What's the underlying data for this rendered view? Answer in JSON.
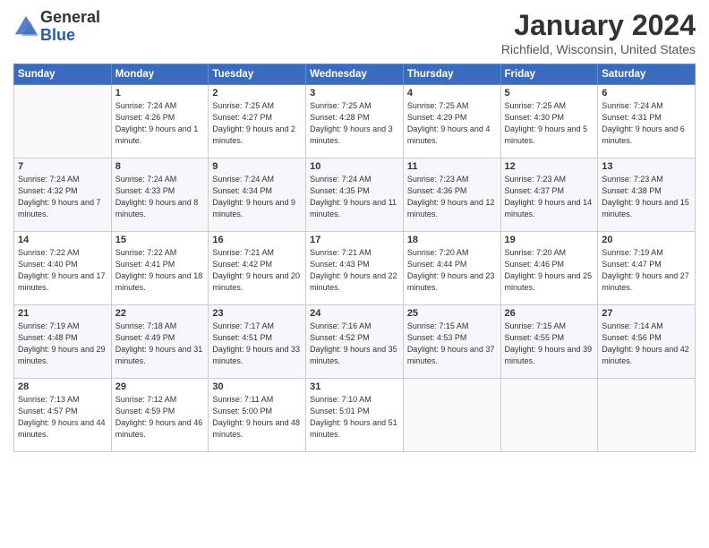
{
  "logo": {
    "general": "General",
    "blue": "Blue"
  },
  "header": {
    "month_year": "January 2024",
    "location": "Richfield, Wisconsin, United States"
  },
  "days_of_week": [
    "Sunday",
    "Monday",
    "Tuesday",
    "Wednesday",
    "Thursday",
    "Friday",
    "Saturday"
  ],
  "weeks": [
    [
      {
        "day": "",
        "sunrise": "",
        "sunset": "",
        "daylight": ""
      },
      {
        "day": "1",
        "sunrise": "Sunrise: 7:24 AM",
        "sunset": "Sunset: 4:26 PM",
        "daylight": "Daylight: 9 hours and 1 minute."
      },
      {
        "day": "2",
        "sunrise": "Sunrise: 7:25 AM",
        "sunset": "Sunset: 4:27 PM",
        "daylight": "Daylight: 9 hours and 2 minutes."
      },
      {
        "day": "3",
        "sunrise": "Sunrise: 7:25 AM",
        "sunset": "Sunset: 4:28 PM",
        "daylight": "Daylight: 9 hours and 3 minutes."
      },
      {
        "day": "4",
        "sunrise": "Sunrise: 7:25 AM",
        "sunset": "Sunset: 4:29 PM",
        "daylight": "Daylight: 9 hours and 4 minutes."
      },
      {
        "day": "5",
        "sunrise": "Sunrise: 7:25 AM",
        "sunset": "Sunset: 4:30 PM",
        "daylight": "Daylight: 9 hours and 5 minutes."
      },
      {
        "day": "6",
        "sunrise": "Sunrise: 7:24 AM",
        "sunset": "Sunset: 4:31 PM",
        "daylight": "Daylight: 9 hours and 6 minutes."
      }
    ],
    [
      {
        "day": "7",
        "sunrise": "Sunrise: 7:24 AM",
        "sunset": "Sunset: 4:32 PM",
        "daylight": "Daylight: 9 hours and 7 minutes."
      },
      {
        "day": "8",
        "sunrise": "Sunrise: 7:24 AM",
        "sunset": "Sunset: 4:33 PM",
        "daylight": "Daylight: 9 hours and 8 minutes."
      },
      {
        "day": "9",
        "sunrise": "Sunrise: 7:24 AM",
        "sunset": "Sunset: 4:34 PM",
        "daylight": "Daylight: 9 hours and 9 minutes."
      },
      {
        "day": "10",
        "sunrise": "Sunrise: 7:24 AM",
        "sunset": "Sunset: 4:35 PM",
        "daylight": "Daylight: 9 hours and 11 minutes."
      },
      {
        "day": "11",
        "sunrise": "Sunrise: 7:23 AM",
        "sunset": "Sunset: 4:36 PM",
        "daylight": "Daylight: 9 hours and 12 minutes."
      },
      {
        "day": "12",
        "sunrise": "Sunrise: 7:23 AM",
        "sunset": "Sunset: 4:37 PM",
        "daylight": "Daylight: 9 hours and 14 minutes."
      },
      {
        "day": "13",
        "sunrise": "Sunrise: 7:23 AM",
        "sunset": "Sunset: 4:38 PM",
        "daylight": "Daylight: 9 hours and 15 minutes."
      }
    ],
    [
      {
        "day": "14",
        "sunrise": "Sunrise: 7:22 AM",
        "sunset": "Sunset: 4:40 PM",
        "daylight": "Daylight: 9 hours and 17 minutes."
      },
      {
        "day": "15",
        "sunrise": "Sunrise: 7:22 AM",
        "sunset": "Sunset: 4:41 PM",
        "daylight": "Daylight: 9 hours and 18 minutes."
      },
      {
        "day": "16",
        "sunrise": "Sunrise: 7:21 AM",
        "sunset": "Sunset: 4:42 PM",
        "daylight": "Daylight: 9 hours and 20 minutes."
      },
      {
        "day": "17",
        "sunrise": "Sunrise: 7:21 AM",
        "sunset": "Sunset: 4:43 PM",
        "daylight": "Daylight: 9 hours and 22 minutes."
      },
      {
        "day": "18",
        "sunrise": "Sunrise: 7:20 AM",
        "sunset": "Sunset: 4:44 PM",
        "daylight": "Daylight: 9 hours and 23 minutes."
      },
      {
        "day": "19",
        "sunrise": "Sunrise: 7:20 AM",
        "sunset": "Sunset: 4:46 PM",
        "daylight": "Daylight: 9 hours and 25 minutes."
      },
      {
        "day": "20",
        "sunrise": "Sunrise: 7:19 AM",
        "sunset": "Sunset: 4:47 PM",
        "daylight": "Daylight: 9 hours and 27 minutes."
      }
    ],
    [
      {
        "day": "21",
        "sunrise": "Sunrise: 7:19 AM",
        "sunset": "Sunset: 4:48 PM",
        "daylight": "Daylight: 9 hours and 29 minutes."
      },
      {
        "day": "22",
        "sunrise": "Sunrise: 7:18 AM",
        "sunset": "Sunset: 4:49 PM",
        "daylight": "Daylight: 9 hours and 31 minutes."
      },
      {
        "day": "23",
        "sunrise": "Sunrise: 7:17 AM",
        "sunset": "Sunset: 4:51 PM",
        "daylight": "Daylight: 9 hours and 33 minutes."
      },
      {
        "day": "24",
        "sunrise": "Sunrise: 7:16 AM",
        "sunset": "Sunset: 4:52 PM",
        "daylight": "Daylight: 9 hours and 35 minutes."
      },
      {
        "day": "25",
        "sunrise": "Sunrise: 7:15 AM",
        "sunset": "Sunset: 4:53 PM",
        "daylight": "Daylight: 9 hours and 37 minutes."
      },
      {
        "day": "26",
        "sunrise": "Sunrise: 7:15 AM",
        "sunset": "Sunset: 4:55 PM",
        "daylight": "Daylight: 9 hours and 39 minutes."
      },
      {
        "day": "27",
        "sunrise": "Sunrise: 7:14 AM",
        "sunset": "Sunset: 4:56 PM",
        "daylight": "Daylight: 9 hours and 42 minutes."
      }
    ],
    [
      {
        "day": "28",
        "sunrise": "Sunrise: 7:13 AM",
        "sunset": "Sunset: 4:57 PM",
        "daylight": "Daylight: 9 hours and 44 minutes."
      },
      {
        "day": "29",
        "sunrise": "Sunrise: 7:12 AM",
        "sunset": "Sunset: 4:59 PM",
        "daylight": "Daylight: 9 hours and 46 minutes."
      },
      {
        "day": "30",
        "sunrise": "Sunrise: 7:11 AM",
        "sunset": "Sunset: 5:00 PM",
        "daylight": "Daylight: 9 hours and 48 minutes."
      },
      {
        "day": "31",
        "sunrise": "Sunrise: 7:10 AM",
        "sunset": "Sunset: 5:01 PM",
        "daylight": "Daylight: 9 hours and 51 minutes."
      },
      {
        "day": "",
        "sunrise": "",
        "sunset": "",
        "daylight": ""
      },
      {
        "day": "",
        "sunrise": "",
        "sunset": "",
        "daylight": ""
      },
      {
        "day": "",
        "sunrise": "",
        "sunset": "",
        "daylight": ""
      }
    ]
  ]
}
